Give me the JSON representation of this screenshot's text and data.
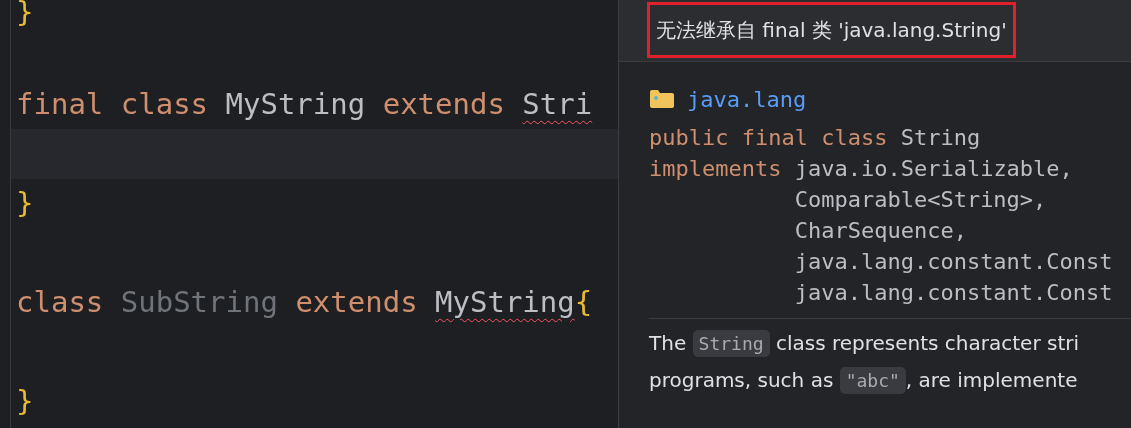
{
  "editor": {
    "lines": [
      {
        "kind": "code",
        "tokens": [
          {
            "text": "}",
            "kind": "brace"
          }
        ]
      },
      {
        "kind": "blank"
      },
      {
        "kind": "code",
        "tokens": [
          {
            "text": "final ",
            "kind": "keyword"
          },
          {
            "text": "class ",
            "kind": "keyword"
          },
          {
            "text": "MyString ",
            "kind": "name"
          },
          {
            "text": "extends ",
            "kind": "keyword"
          },
          {
            "text": "Stri",
            "kind": "name",
            "error": true
          }
        ]
      },
      {
        "kind": "caret"
      },
      {
        "kind": "code",
        "tokens": [
          {
            "text": "}",
            "kind": "brace"
          }
        ]
      },
      {
        "kind": "blank"
      },
      {
        "kind": "code",
        "tokens": [
          {
            "text": "class ",
            "kind": "keyword"
          },
          {
            "text": "SubString ",
            "kind": "unused"
          },
          {
            "text": "extends ",
            "kind": "keyword"
          },
          {
            "text": "MyString",
            "kind": "name",
            "error": true
          },
          {
            "text": "{",
            "kind": "brace"
          }
        ]
      },
      {
        "kind": "blank"
      },
      {
        "kind": "code",
        "tokens": [
          {
            "text": "}",
            "kind": "brace"
          }
        ]
      }
    ]
  },
  "popup": {
    "message": "无法继承自 final 类 'java.lang.String'",
    "package": "java.lang",
    "signature": [
      [
        {
          "text": "public final class",
          "kind": "keyword"
        },
        {
          "text": " String",
          "kind": "plain"
        }
      ],
      [
        {
          "text": "implements",
          "kind": "keyword"
        },
        {
          "text": " java.io.Serializable,",
          "kind": "plain"
        }
      ],
      [
        {
          "text": "           Comparable<String>,",
          "kind": "plain"
        }
      ],
      [
        {
          "text": "           CharSequence,",
          "kind": "plain"
        }
      ],
      [
        {
          "text": "           java.lang.constant.Const",
          "kind": "plain"
        }
      ],
      [
        {
          "text": "           java.lang.constant.Const",
          "kind": "plain"
        }
      ]
    ],
    "description": [
      [
        {
          "text": "The ",
          "kind": "text"
        },
        {
          "text": "String",
          "kind": "code"
        },
        {
          "text": " class represents character stri",
          "kind": "text"
        }
      ],
      [
        {
          "text": "programs, such as ",
          "kind": "text"
        },
        {
          "text": "\"abc\"",
          "kind": "code"
        },
        {
          "text": ", are implemente",
          "kind": "text"
        }
      ]
    ]
  }
}
